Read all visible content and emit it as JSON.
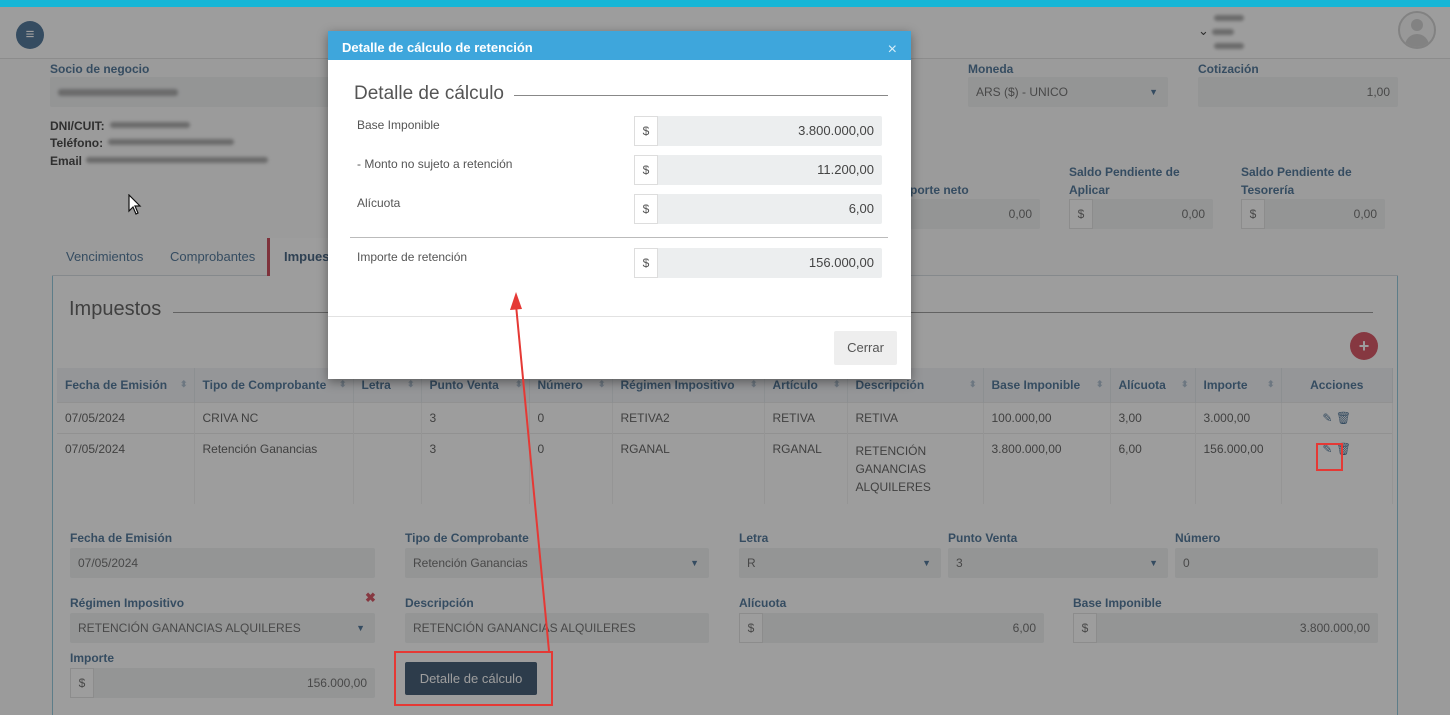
{
  "header": {
    "menu_icon": "hamburger-icon",
    "avatar_icon": "user-avatar-icon"
  },
  "form_top": {
    "socio_label": "Socio de negocio",
    "dni_label": "DNI/CUIT:",
    "telefono_label": "Teléfono:",
    "email_label": "Email",
    "moneda_label": "Moneda",
    "moneda_value": "ARS ($) - UNICO",
    "cotizacion_label": "Cotización",
    "cotizacion_value": "1,00",
    "importe_neto_label": "porte neto",
    "importe_neto_value": "0,00",
    "saldo_aplicar_label_1": "Saldo Pendiente de",
    "saldo_aplicar_label_2": "Aplicar",
    "saldo_aplicar_value": "0,00",
    "saldo_tesoreria_label_1": "Saldo Pendiente de",
    "saldo_tesoreria_label_2": "Tesorería",
    "saldo_tesoreria_value": "0,00",
    "currency_symbol": "$"
  },
  "tabs": [
    {
      "label": "Vencimientos"
    },
    {
      "label": "Comprobantes"
    },
    {
      "label": "Impues"
    }
  ],
  "impuestos": {
    "title": "Impuestos",
    "columns": [
      "Fecha de Emisión",
      "Tipo de Comprobante",
      "Letra",
      "Punto Venta",
      "Número",
      "Régimen Impositivo",
      "Artículo",
      "Descripción",
      "Base Imponible",
      "Alícuota",
      "Importe",
      "Acciones"
    ],
    "rows": [
      [
        "07/05/2024",
        "CRIVA NC",
        "",
        "3",
        "0",
        "RETIVA2",
        "RETIVA",
        "RETIVA",
        "100.000,00",
        "3,00",
        "3.000,00"
      ],
      [
        "07/05/2024",
        "Retención Ganancias",
        "",
        "3",
        "0",
        "RGANAL",
        "RGANAL",
        "RETENCIÓN GANANCIAS ALQUILERES",
        "3.800.000,00",
        "6,00",
        "156.000,00"
      ]
    ]
  },
  "edit_form": {
    "fecha_label": "Fecha de Emisión",
    "fecha_value": "07/05/2024",
    "tipo_label": "Tipo de Comprobante",
    "tipo_value": "Retención Ganancias",
    "letra_label": "Letra",
    "letra_value": "R",
    "punto_label": "Punto Venta",
    "punto_value": "3",
    "numero_label": "Número",
    "numero_value": "0",
    "regimen_label": "Régimen Impositivo",
    "regimen_value": "RETENCIÓN GANANCIAS ALQUILERES",
    "descripcion_label": "Descripción",
    "descripcion_value": "RETENCIÓN GANANCIAS ALQUILERES",
    "alicuota_label": "Alícuota",
    "alicuota_value": "6,00",
    "base_label": "Base Imponible",
    "base_value": "3.800.000,00",
    "importe_label": "Importe",
    "importe_value": "156.000,00",
    "calc_button": "Detalle de cálculo"
  },
  "modal": {
    "header": "Detalle de cálculo de retención",
    "close_glyph": "×",
    "title": "Detalle de cálculo",
    "rows": [
      {
        "label": "Base Imponible",
        "value": "3.800.000,00"
      },
      {
        "label": "- Monto no sujeto a retención",
        "value": "11.200,00"
      },
      {
        "label": "Alícuota",
        "value": "6,00"
      }
    ],
    "total_label": "Importe de retención",
    "total_value": "156.000,00",
    "close_button": "Cerrar"
  },
  "colors": {
    "accent_blue": "#3ea6dc",
    "top_bar": "#16b6d6",
    "annotation_red": "#e53935",
    "primary_dark": "#1f3d5a"
  }
}
